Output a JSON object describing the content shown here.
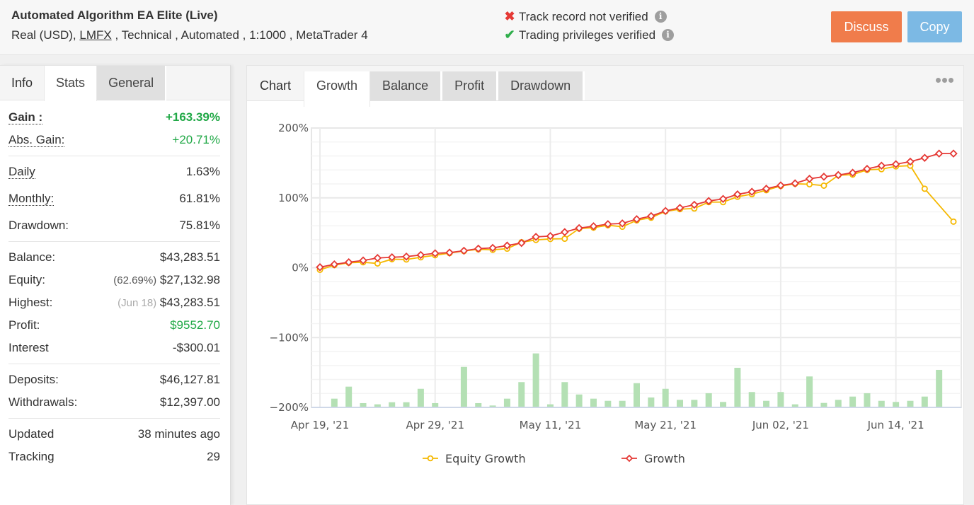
{
  "header": {
    "title": "Automated Algorithm EA Elite (Live)",
    "sub_prefix": "Real (USD),",
    "broker_link": "LMFX",
    "sub_suffix": ", Technical , Automated , 1:1000 , MetaTrader 4",
    "verify": [
      {
        "icon": "x-icon",
        "text": "Track record not verified",
        "status": "not-verified"
      },
      {
        "icon": "check-icon",
        "text": "Trading privileges verified",
        "status": "verified"
      }
    ],
    "discuss_label": "Discuss",
    "copy_label": "Copy",
    "info_glyph": "i"
  },
  "left_tabs": [
    "Info",
    "Stats",
    "General"
  ],
  "stats": {
    "gain": {
      "label": "Gain :",
      "value": "+163.39%"
    },
    "abs_gain": {
      "label": "Abs. Gain:",
      "value": "+20.71%"
    },
    "daily": {
      "label": "Daily",
      "value": "1.63%"
    },
    "monthly": {
      "label": "Monthly:",
      "value": "61.81%"
    },
    "drawdown": {
      "label": "Drawdown:",
      "value": "75.81%"
    },
    "balance": {
      "label": "Balance:",
      "value": "$43,283.51"
    },
    "equity": {
      "label": "Equity:",
      "note": "(62.69%)",
      "value": "$27,132.98"
    },
    "highest": {
      "label": "Highest:",
      "note": "(Jun 18)",
      "value": "$43,283.51"
    },
    "profit": {
      "label": "Profit:",
      "value": "$9552.70"
    },
    "interest": {
      "label": "Interest",
      "value": "-$300.01"
    },
    "deposits": {
      "label": "Deposits:",
      "value": "$46,127.81"
    },
    "withdrawals": {
      "label": "Withdrawals:",
      "value": "$12,397.00"
    },
    "updated": {
      "label": "Updated",
      "value": "38 minutes ago"
    },
    "tracking": {
      "label": "Tracking",
      "value": "29"
    }
  },
  "chart_tabs": {
    "label": "Chart",
    "tabs": [
      "Growth",
      "Balance",
      "Profit",
      "Drawdown"
    ],
    "active": "Growth"
  },
  "colors": {
    "growth": "#e53935",
    "equity": "#f5b800",
    "bars": "#b4e0b4",
    "discuss": "#f07c4b",
    "copy": "#7cb9e4",
    "positive": "#20a846"
  },
  "chart_data": {
    "type": "line",
    "title": "",
    "xlabel": "",
    "ylabel": "",
    "ylim": [
      -200,
      200
    ],
    "yticks": [
      "200%",
      "100%",
      "0%",
      "-100%",
      "-200%"
    ],
    "ytick_values": [
      200,
      100,
      0,
      -100,
      -200
    ],
    "xtick_labels": [
      "Apr 19, '21",
      "Apr 29, '21",
      "May 11, '21",
      "May 21, '21",
      "Jun 02, '21",
      "Jun 14, '21"
    ],
    "xtick_indices": [
      0,
      8,
      16,
      24,
      32,
      40
    ],
    "grid": true,
    "legend": "bottom",
    "point_count": 45,
    "series": [
      {
        "name": "Equity Growth",
        "marker": "circle",
        "values": [
          -3,
          3.7,
          7.1,
          7.8,
          6.1,
          12.2,
          11.8,
          14.9,
          17.9,
          20.9,
          23.9,
          26.3,
          25.6,
          27.3,
          36.5,
          39.8,
          41.2,
          41.5,
          56,
          57.4,
          60.8,
          58.7,
          67.8,
          71.6,
          80.7,
          83.8,
          84.8,
          93.9,
          93.9,
          101.6,
          105.3,
          111,
          117,
          120.2,
          119.5,
          117.5,
          132.3,
          133.3,
          140.1,
          141.1,
          145.1,
          146.1,
          113.1,
          null,
          66
        ]
      },
      {
        "name": "Growth",
        "marker": "diamond",
        "values": [
          0.7,
          4.8,
          7.8,
          10.4,
          13.9,
          14.9,
          15.9,
          18.2,
          20.6,
          21.6,
          24.3,
          27.3,
          28.4,
          31.7,
          35.4,
          44.2,
          45.3,
          51,
          56.7,
          59.4,
          62.4,
          63.4,
          69.5,
          73.9,
          81.3,
          85.7,
          90.1,
          95.5,
          98.5,
          105,
          108.7,
          113.1,
          117.8,
          120.8,
          127.3,
          130.3,
          132.7,
          136,
          141.5,
          146.1,
          148.2,
          151.9,
          157.3,
          163.4,
          163.4
        ]
      }
    ],
    "bars": {
      "name": "Daily",
      "baseline": -200,
      "values": [
        1,
        12.5,
        29.7,
        6.1,
        4.4,
        7.4,
        7.4,
        26.6,
        6.1,
        1,
        58,
        6.1,
        2.7,
        12.5,
        36.2,
        77.3,
        4.4,
        36.2,
        18.5,
        12.5,
        9.4,
        9.4,
        34.7,
        14.2,
        26.6,
        10.8,
        10.8,
        20.3,
        7.8,
        56.7,
        22,
        9.4,
        22,
        4.4,
        44.3,
        6.4,
        10.8,
        15.5,
        20.3,
        9.4,
        7.8,
        9.4,
        15.5,
        53.7,
        1
      ]
    }
  }
}
